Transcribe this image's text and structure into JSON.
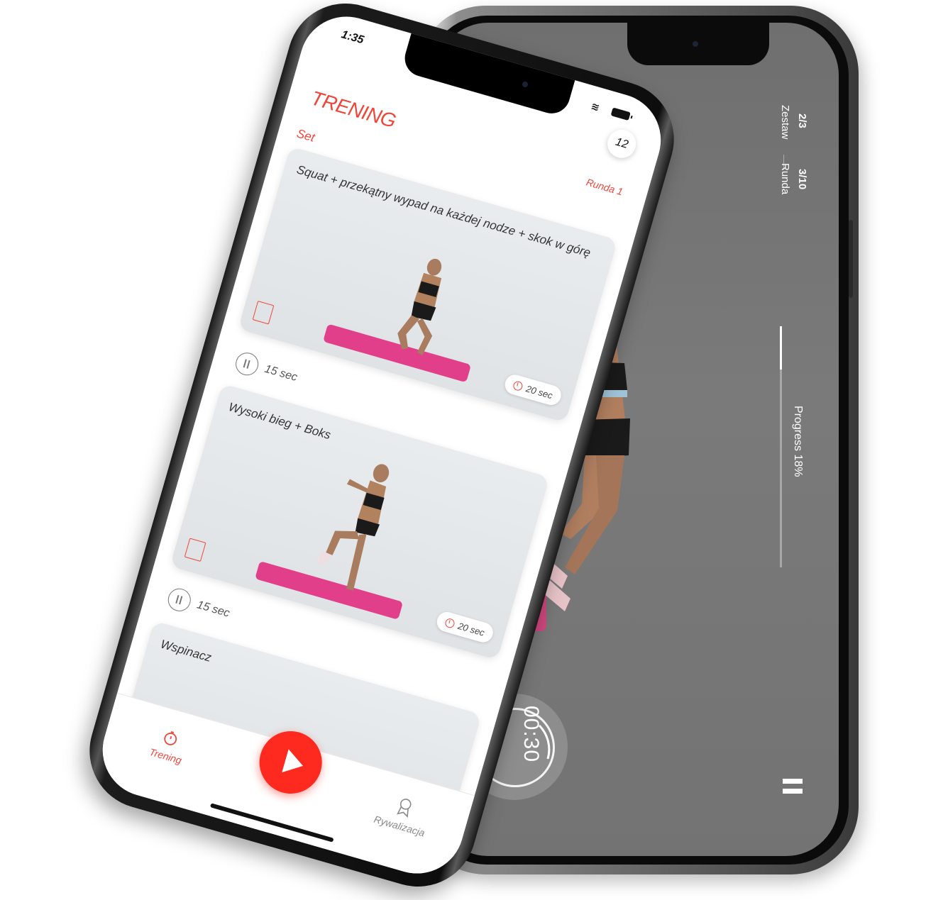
{
  "front": {
    "status": {
      "time": "1:35"
    },
    "notification_count": "12",
    "header": {
      "title": "TRENING",
      "round_label": "Runda 1"
    },
    "set_label": "Set",
    "exercises": [
      {
        "title": "Squat + przekątny wypad na każdej nodze + skok w górę",
        "duration": "20 sec"
      },
      {
        "title": "Wysoki bieg + Boks",
        "duration": "20 sec"
      },
      {
        "title": "Wspinacz",
        "duration": ""
      }
    ],
    "rests": [
      {
        "label": "15 sec"
      },
      {
        "label": "15 sec"
      }
    ],
    "nav": {
      "left_label": "Trening",
      "right_label": "Rywalizacja"
    }
  },
  "back": {
    "set_value": "2/3",
    "set_label": "Zestaw",
    "round_value": "3/10",
    "round_label": "Runda",
    "progress_label": "Progress 18%",
    "progress_fraction": 0.18,
    "timer": "00:30"
  },
  "colors": {
    "accent": "#f0463a",
    "play_button": "#ff2a1f",
    "mat": "#e23f8a",
    "player_bg": "#737373"
  },
  "icons": {
    "play": "play-icon",
    "pause": "pause-icon",
    "clock": "clock-icon",
    "award": "award-icon",
    "stopwatch": "stopwatch-icon"
  }
}
